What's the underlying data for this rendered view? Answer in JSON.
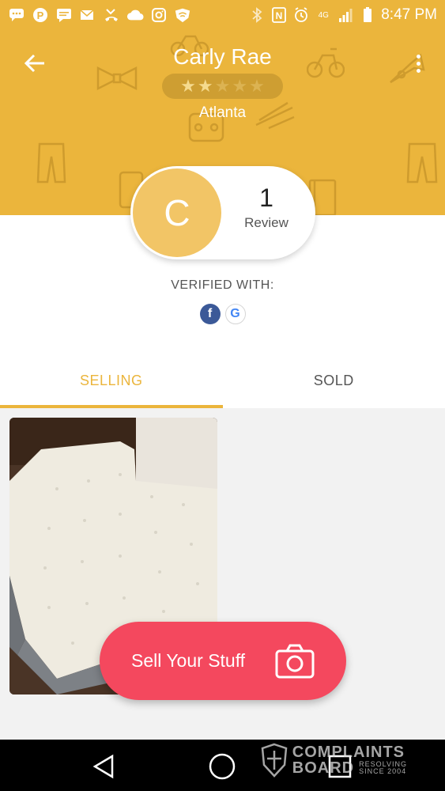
{
  "status_bar": {
    "time": "8:47 PM",
    "network": "4G"
  },
  "header": {
    "user_name": "Carly Rae",
    "rating": 2,
    "rating_max": 5,
    "location": "Atlanta",
    "background_color": "#EBB53C"
  },
  "profile": {
    "avatar_letter": "C",
    "review_count": "1",
    "review_label": "Review"
  },
  "verified": {
    "label": "VERIFIED WITH:",
    "providers": [
      "facebook-icon",
      "google-icon"
    ],
    "facebook_glyph": "f",
    "google_glyph": "G"
  },
  "tabs": {
    "selling": "SELLING",
    "sold": "SOLD",
    "active": "selling"
  },
  "listing": {
    "image": "mattress-photo"
  },
  "fab": {
    "label": "Sell Your Stuff",
    "color": "#F4485E"
  },
  "watermark": {
    "line1": "COMPLAINTS",
    "line2": "BOARD",
    "line3": "RESOLVING",
    "line4": "SINCE 2004"
  }
}
